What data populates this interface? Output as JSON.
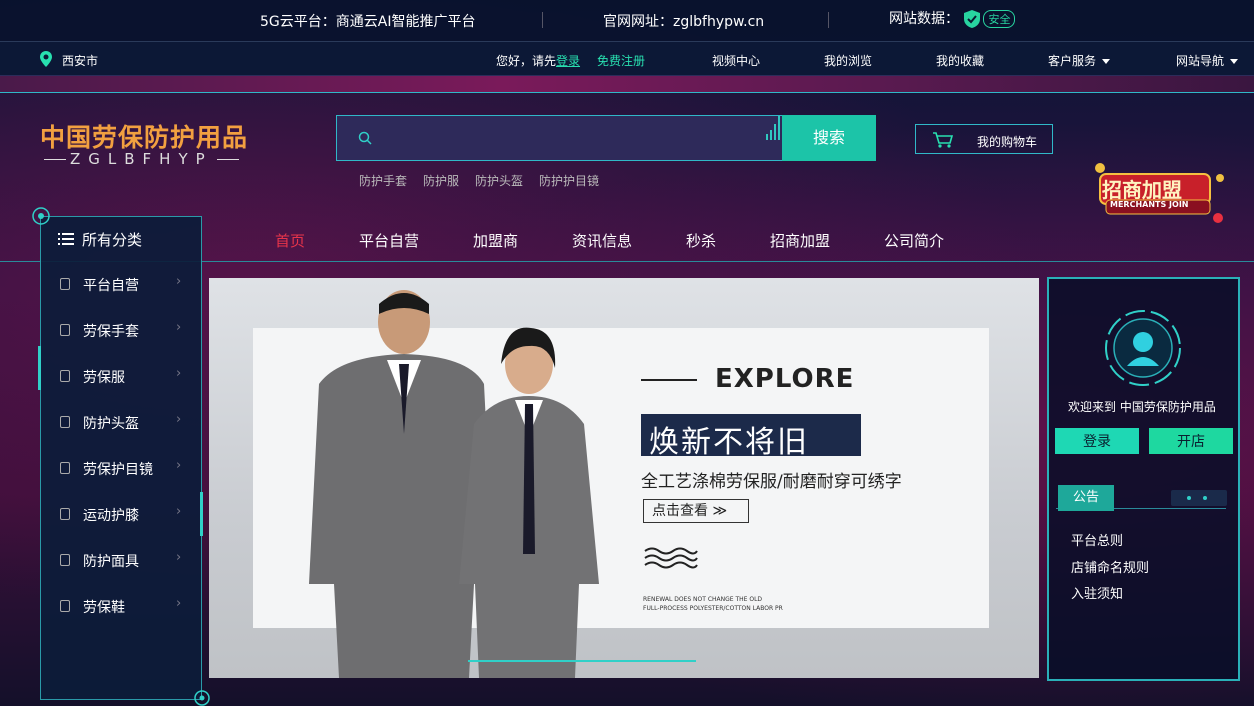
{
  "topbar": {
    "platform": "5G云平台：商通云AI智能推广平台",
    "site_label": "官网网址：",
    "site_url": "zglbfhypw.cn",
    "data_label": "网站数据：",
    "safe_badge": "安全"
  },
  "navbar": {
    "city": "西安市",
    "greeting": "您好，请先",
    "login": "登录",
    "register": "免费注册",
    "links": [
      "视频中心",
      "我的浏览",
      "我的收藏",
      "客户服务",
      "网站导航"
    ]
  },
  "header": {
    "logo_cn": "中国劳保防护用品",
    "logo_en": "ZGLBFHYP",
    "search_placeholder": "",
    "search_button": "搜索",
    "hot_words": [
      "防护手套",
      "防护服",
      "防护头盔",
      "防护护目镜"
    ],
    "cart_label": "我的购物车",
    "merchant_badge_cn": "招商加盟",
    "merchant_badge_en": "MERCHANTS JOIN"
  },
  "mainnav": {
    "items": [
      "首页",
      "平台自营",
      "加盟商",
      "资讯信息",
      "秒杀",
      "招商加盟",
      "公司简介"
    ],
    "active_color": "#e8344a"
  },
  "sidebar": {
    "title": "所有分类",
    "items": [
      "平台自营",
      "劳保手套",
      "劳保服",
      "防护头盔",
      "劳保护目镜",
      "运动护膝",
      "防护面具",
      "劳保鞋"
    ]
  },
  "banner": {
    "explore": "EXPLORE",
    "headline": "焕新不将旧",
    "subline": "全工艺涤棉劳保服/耐磨耐穿可绣字",
    "cta": "点击查看 ≫",
    "fine1": "RENEWAL DOES NOT CHANGE THE OLD",
    "fine2": "FULL-PROCESS POLYESTER/COTTON LABOR PR"
  },
  "rpanel": {
    "welcome": "欢迎来到 中国劳保防护用品",
    "login": "登录",
    "open_shop": "开店",
    "notice_tab": "公告",
    "notices": [
      "平台总则",
      "店铺命名规则",
      "入驻须知"
    ]
  }
}
